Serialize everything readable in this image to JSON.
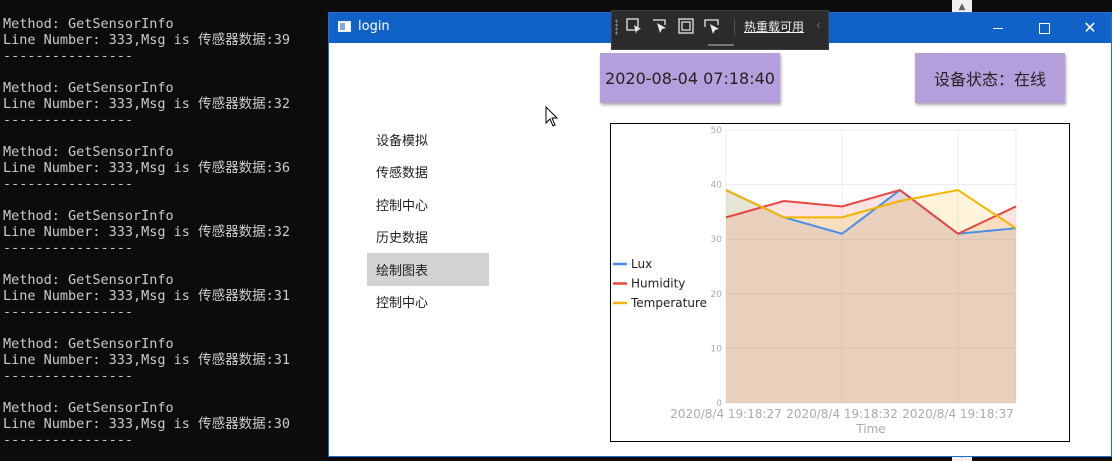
{
  "console": {
    "entries": [
      {
        "method": "Method: GetSensorInfo",
        "message": "Line Number: 333,Msg is 传感器数据:39",
        "separator": "----------------"
      },
      {
        "method": "Method: GetSensorInfo",
        "message": "Line Number: 333,Msg is 传感器数据:32",
        "separator": "----------------"
      },
      {
        "method": "Method: GetSensorInfo",
        "message": "Line Number: 333,Msg is 传感器数据:36",
        "separator": "----------------"
      },
      {
        "method": "Method: GetSensorInfo",
        "message": "Line Number: 333,Msg is 传感器数据:32",
        "separator": "----------------"
      },
      {
        "method": "Method: GetSensorInfo",
        "message": "Line Number: 333,Msg is 传感器数据:31",
        "separator": "----------------"
      },
      {
        "method": "Method: GetSensorInfo",
        "message": "Line Number: 333,Msg is 传感器数据:31",
        "separator": "----------------"
      },
      {
        "method": "Method: GetSensorInfo",
        "message": "Line Number: 333,Msg is 传感器数据:30",
        "separator": "----------------"
      }
    ]
  },
  "window": {
    "title": "login",
    "controls": {
      "minimize": "minimize-icon",
      "maximize": "maximize-icon",
      "close": "close-icon"
    }
  },
  "hot_reload": {
    "label": "热重载可用",
    "tools": [
      "select-element-icon",
      "pointer-icon",
      "display-layout-icon",
      "track-focus-icon"
    ]
  },
  "header": {
    "datetime": "2020-08-04 07:18:40",
    "device_status": "设备状态：在线"
  },
  "nav": {
    "items": [
      {
        "label": "设备模拟",
        "selected": false
      },
      {
        "label": "传感数据",
        "selected": false
      },
      {
        "label": "控制中心",
        "selected": false
      },
      {
        "label": "历史数据",
        "selected": false
      },
      {
        "label": "绘制图表",
        "selected": true
      },
      {
        "label": "控制中心",
        "selected": false
      }
    ]
  },
  "colors": {
    "accent": "#1062c8",
    "status_box": "#b49fdc",
    "lux": "#4a90e2",
    "humidity": "#e8473f",
    "temperature": "#f5b400"
  },
  "chart_data": {
    "type": "area",
    "x": [
      0,
      1,
      2,
      3,
      4,
      5
    ],
    "x_tick_labels": [
      "2020/8/4 19:18:27",
      "2020/8/4 19:18:32",
      "2020/8/4 19:18:37"
    ],
    "x_tick_positions": [
      0,
      2,
      4
    ],
    "xlabel": "Time",
    "ylabel": "",
    "ylim": [
      0,
      50
    ],
    "y_ticks": [
      0,
      10,
      20,
      30,
      40,
      50
    ],
    "grid": true,
    "legend_position": "left",
    "series": [
      {
        "name": "Lux",
        "color": "#4a90e2",
        "values": [
          39,
          34,
          31,
          39,
          31,
          32
        ]
      },
      {
        "name": "Humidity",
        "color": "#e8473f",
        "values": [
          34,
          37,
          36,
          39,
          31,
          36
        ]
      },
      {
        "name": "Temperature",
        "color": "#f5b400",
        "values": [
          39,
          34,
          34,
          37,
          39,
          32
        ]
      }
    ]
  }
}
